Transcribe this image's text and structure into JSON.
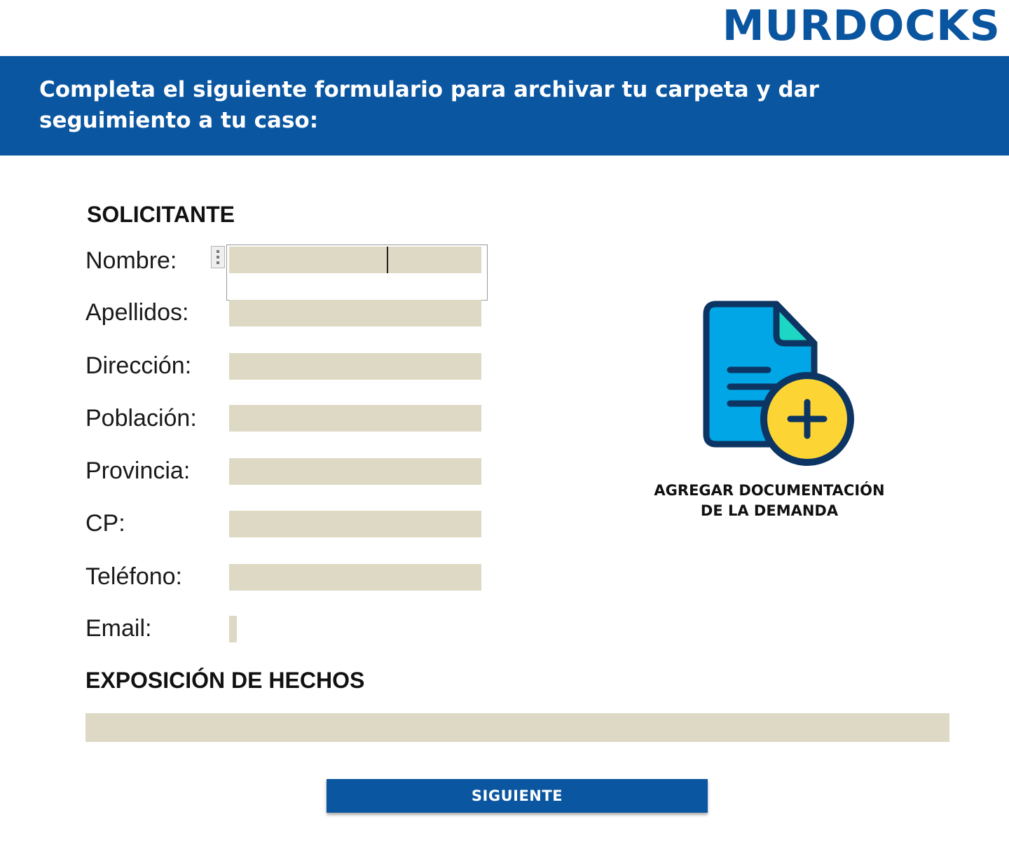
{
  "header": {
    "logo": "MURDOCKS",
    "banner_text": "Completa el siguiente formulario para archivar tu carpeta y dar seguimiento a tu caso:"
  },
  "form": {
    "section_applicant": "SOLICITANTE",
    "fields": [
      {
        "label": "Nombre:",
        "value": ""
      },
      {
        "label": "Apellidos:",
        "value": ""
      },
      {
        "label": "Dirección:",
        "value": ""
      },
      {
        "label": "Población:",
        "value": ""
      },
      {
        "label": "Provincia:",
        "value": ""
      },
      {
        "label": "CP:",
        "value": ""
      },
      {
        "label": "Teléfono:",
        "value": ""
      },
      {
        "label": "Email:",
        "value": ""
      }
    ],
    "section_facts": "EXPOSICIÓN DE HECHOS",
    "facts_value": ""
  },
  "upload": {
    "icon": "document-add-icon",
    "caption_line1": "AGREGAR DOCUMENTACIÓN",
    "caption_line2": "DE LA DEMANDA"
  },
  "actions": {
    "next_label": "SIGUIENTE"
  },
  "colors": {
    "brand_blue": "#0a56a0",
    "field_fill": "#ded9c4",
    "doc_blue": "#00a6e6",
    "doc_outline": "#0d3563",
    "plus_yellow": "#fcd535",
    "corner_teal": "#1ed6c4"
  }
}
